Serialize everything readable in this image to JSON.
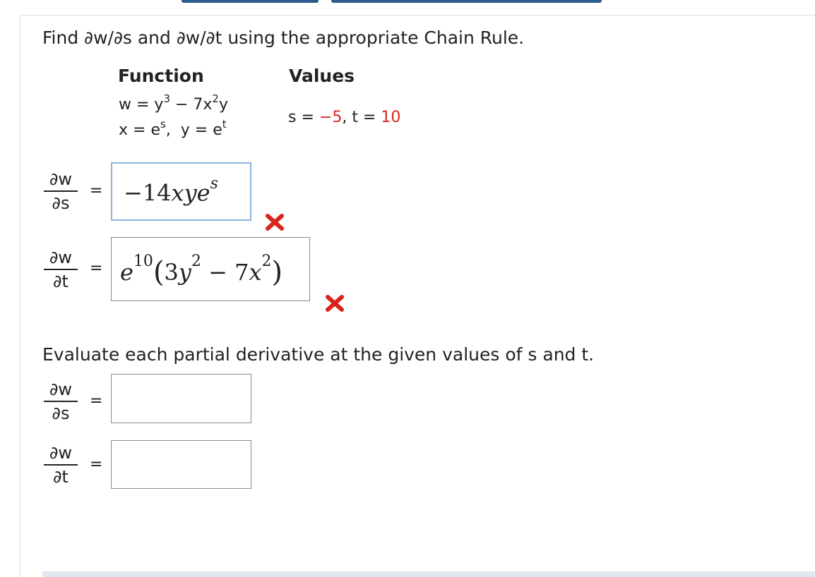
{
  "question": {
    "prompt": "Find ∂w/∂s and ∂w/∂t using the appropriate Chain Rule.",
    "function_header": "Function",
    "values_header": "Values",
    "function_line1": "w = y³ − 7x²y",
    "function_line2": "x = eˢ, y = eᵗ",
    "values_s_label": "s = ",
    "values_s_value": "−5",
    "values_sep": ",  t = ",
    "values_t_value": "10"
  },
  "derivatives": {
    "dw_num": "∂w",
    "ds_den": "∂s",
    "dt_den": "∂t",
    "equals": "="
  },
  "answers": {
    "dw_ds": {
      "value": "−14xyeˢ",
      "status": "incorrect"
    },
    "dw_dt": {
      "value": "e¹⁰(3y² − 7x²)",
      "status": "incorrect"
    }
  },
  "evaluate": {
    "prompt": "Evaluate each partial derivative at the given values of s and t.",
    "dw_ds_value": "",
    "dw_dt_value": ""
  },
  "colors": {
    "incorrect": "#d9261c",
    "focus_border": "#8fb4dd",
    "bar": "#2c5a8c"
  },
  "icons": {
    "incorrect": "cross-icon"
  }
}
